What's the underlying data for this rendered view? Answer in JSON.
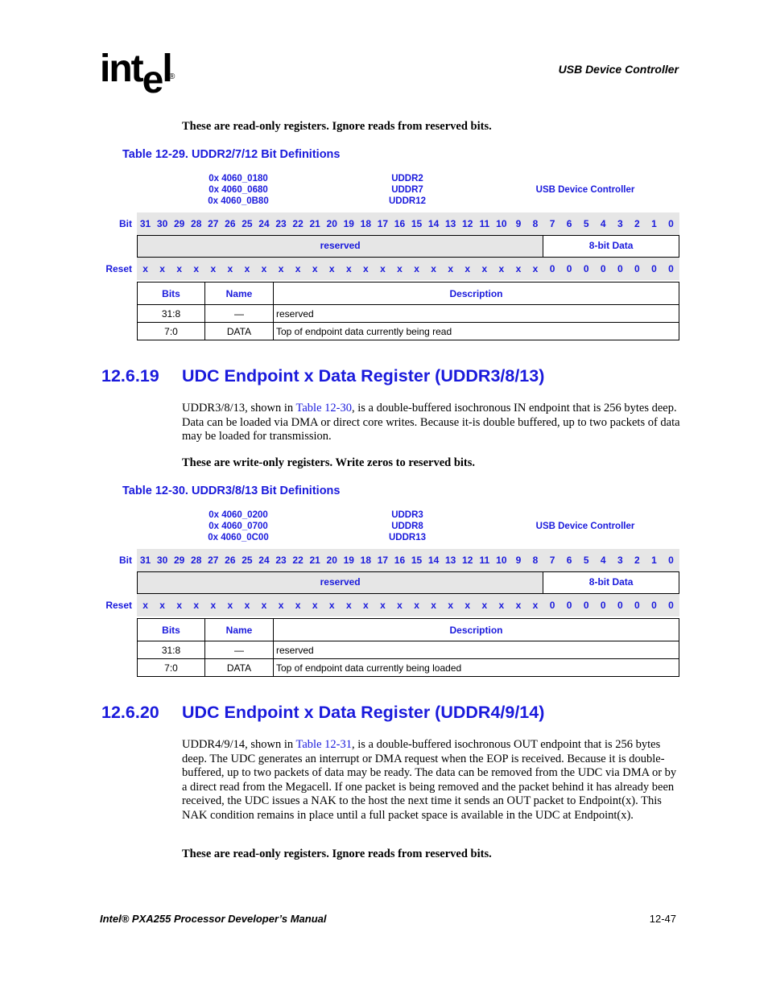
{
  "header": {
    "logo_text": "int",
    "logo_e": "e",
    "logo_l": "l",
    "logo_registered": "®",
    "chapter_title": "USB Device Controller"
  },
  "blocks": [
    {
      "intro_note": "These are read-only registers. Ignore reads from reserved bits.",
      "caption": "Table 12-29. UDDR2/7/12 Bit Definitions",
      "addresses": [
        "0x 4060_0180",
        "0x 4060_0680",
        "0x 4060_0B80"
      ],
      "registers": [
        "UDDR2",
        "UDDR7",
        "UDDR12"
      ],
      "unit": "USB Device Controller",
      "bit_label": "Bit",
      "reset_label": "Reset",
      "bits": [
        "31",
        "30",
        "29",
        "28",
        "27",
        "26",
        "25",
        "24",
        "23",
        "22",
        "21",
        "20",
        "19",
        "18",
        "17",
        "16",
        "15",
        "14",
        "13",
        "12",
        "11",
        "10",
        "9",
        "8",
        "7",
        "6",
        "5",
        "4",
        "3",
        "2",
        "1",
        "0"
      ],
      "fields": [
        {
          "label": "reserved",
          "span_bits": 24,
          "type": "reserved"
        },
        {
          "label": "8-bit Data",
          "span_bits": 8,
          "type": "data"
        }
      ],
      "reset": [
        "x",
        "x",
        "x",
        "x",
        "x",
        "x",
        "x",
        "x",
        "x",
        "x",
        "x",
        "x",
        "x",
        "x",
        "x",
        "x",
        "x",
        "x",
        "x",
        "x",
        "x",
        "x",
        "x",
        "x",
        "0",
        "0",
        "0",
        "0",
        "0",
        "0",
        "0",
        "0"
      ],
      "desc_headers": [
        "Bits",
        "Name",
        "Description"
      ],
      "desc_rows": [
        [
          "31:8",
          "—",
          "reserved"
        ],
        [
          "7:0",
          "DATA",
          "Top of endpoint data currently being read"
        ]
      ]
    },
    {
      "section_number": "12.6.19",
      "section_title": "UDC Endpoint x Data Register (UDDR3/8/13)",
      "para_before": "UDDR3/8/13, shown in ",
      "para_link": "Table 12-30",
      "para_after": ", is a double-buffered isochronous IN endpoint that is 256 bytes deep. Data can be loaded via DMA or direct core writes. Because it-is double buffered, up to two packets of data may be loaded for transmission.",
      "intro_note": "These are write-only registers. Write zeros to reserved bits.",
      "caption": "Table 12-30. UDDR3/8/13 Bit Definitions",
      "addresses": [
        "0x 4060_0200",
        "0x 4060_0700",
        "0x 4060_0C00"
      ],
      "registers": [
        "UDDR3",
        "UDDR8",
        "UDDR13"
      ],
      "unit": "USB Device Controller",
      "bit_label": "Bit",
      "reset_label": "Reset",
      "bits": [
        "31",
        "30",
        "29",
        "28",
        "27",
        "26",
        "25",
        "24",
        "23",
        "22",
        "21",
        "20",
        "19",
        "18",
        "17",
        "16",
        "15",
        "14",
        "13",
        "12",
        "11",
        "10",
        "9",
        "8",
        "7",
        "6",
        "5",
        "4",
        "3",
        "2",
        "1",
        "0"
      ],
      "fields": [
        {
          "label": "reserved",
          "span_bits": 24,
          "type": "reserved"
        },
        {
          "label": "8-bit Data",
          "span_bits": 8,
          "type": "data"
        }
      ],
      "reset": [
        "x",
        "x",
        "x",
        "x",
        "x",
        "x",
        "x",
        "x",
        "x",
        "x",
        "x",
        "x",
        "x",
        "x",
        "x",
        "x",
        "x",
        "x",
        "x",
        "x",
        "x",
        "x",
        "x",
        "x",
        "0",
        "0",
        "0",
        "0",
        "0",
        "0",
        "0",
        "0"
      ],
      "desc_headers": [
        "Bits",
        "Name",
        "Description"
      ],
      "desc_rows": [
        [
          "31:8",
          "—",
          "reserved"
        ],
        [
          "7:0",
          "DATA",
          "Top of endpoint data currently being loaded"
        ]
      ]
    }
  ],
  "section_20": {
    "section_number": "12.6.20",
    "section_title": "UDC Endpoint x Data Register (UDDR4/9/14)",
    "para_before": "UDDR4/9/14, shown in ",
    "para_link": "Table 12-31",
    "para_after": ", is a double-buffered isochronous OUT endpoint that is 256 bytes deep. The UDC generates an interrupt or DMA request when the EOP is received. Because it is double-buffered, up to two packets of data may be ready. The data can be removed from the UDC via DMA or by a direct read from the Megacell. If one packet is being removed and the packet behind it has already been received, the UDC issues a NAK to the host the next time it sends an OUT packet to Endpoint(x). This NAK condition remains in place until a full packet space is available in the UDC at Endpoint(x).",
    "note": "These are read-only registers. Ignore reads from reserved bits."
  },
  "footer": {
    "manual_title": "Intel® PXA255 Processor Developer’s Manual",
    "page_number": "12-47"
  }
}
